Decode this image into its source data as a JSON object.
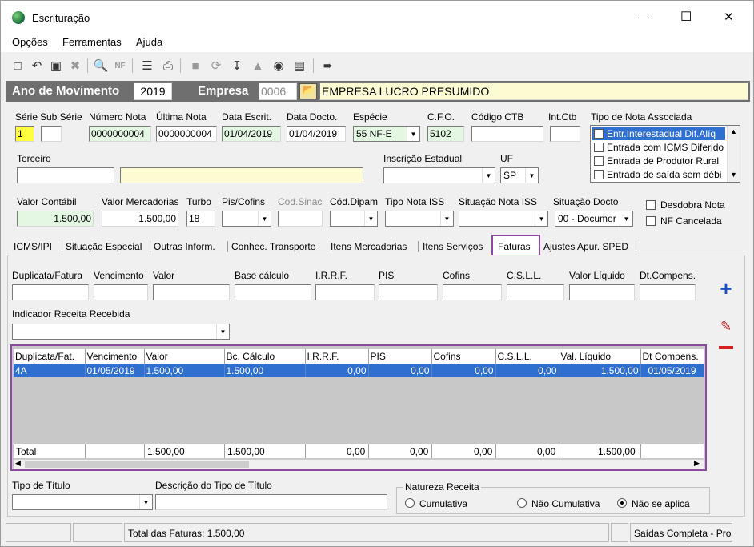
{
  "window": {
    "title": "Escrituração",
    "minimize": "—",
    "maximize": "☐",
    "close": "✕"
  },
  "menu": {
    "opcoes": "Opções",
    "ferramentas": "Ferramentas",
    "ajuda": "Ajuda"
  },
  "toolbar_icons": [
    "new-document-icon",
    "undo-icon",
    "save-icon",
    "delete-icon",
    "preview-icon",
    "nfe-icon",
    "tree-icon",
    "print-icon",
    "open-folder-icon",
    "refresh-icon",
    "import-icon",
    "tree-gray-icon",
    "money-bag-icon",
    "register-icon",
    "exit-icon"
  ],
  "header": {
    "ano_label": "Ano de Movimento",
    "ano_value": "2019",
    "empresa_label": "Empresa",
    "empresa_code": "0006",
    "empresa_name": "EMPRESA LUCRO PRESUMIDO"
  },
  "fields": {
    "serie_label": "Série",
    "serie": "1",
    "subserie_label": "Sub Série",
    "subserie": "",
    "numero_nota_label": "Número Nota",
    "numero_nota": "0000000004",
    "ultima_nota_label": "Última Nota",
    "ultima_nota": "0000000004",
    "data_escrit_label": "Data Escrit.",
    "data_escrit": "01/04/2019",
    "data_docto_label": "Data Docto.",
    "data_docto": "01/04/2019",
    "especie_label": "Espécie",
    "especie": "55  NF-E",
    "cfo_label": "C.F.O.",
    "cfo": "5102",
    "codigo_ctb_label": "Código CTB",
    "codigo_ctb": "",
    "int_ctb_label": "Int.Ctb",
    "int_ctb": "",
    "tipo_nota_assoc_label": "Tipo de Nota Associada",
    "tipo_nota_assoc_items": [
      "Entr.Interestadual Dif.Alíq",
      "Entrada com ICMS Diferido",
      "Entrada de Produtor Rural",
      "Entrada de saída sem débi"
    ],
    "terceiro_label": "Terceiro",
    "terceiro_code": "",
    "terceiro_name": "",
    "inscricao_label": "Inscrição Estadual",
    "inscricao": "",
    "uf_label": "UF",
    "uf": "SP",
    "valor_contabil_label": "Valor Contábil",
    "valor_contabil": "1.500,00",
    "valor_merc_label": "Valor Mercadorias",
    "valor_merc": "1.500,00",
    "turbo_label": "Turbo",
    "turbo": "18",
    "pis_cofins_label": "Pis/Cofins",
    "pis_cofins": "",
    "cod_sinac_label": "Cod.Sinac",
    "cod_sinac": "",
    "cod_dipam_label": "Cód.Dipam",
    "cod_dipam": "",
    "tipo_nota_iss_label": "Tipo Nota ISS",
    "tipo_nota_iss": "",
    "situacao_iss_label": "Situação Nota ISS",
    "situacao_iss": "",
    "situacao_docto_label": "Situação Docto",
    "situacao_docto": "00 - Documer",
    "desdobra_label": "Desdobra Nota",
    "nf_cancelada_label": "NF Cancelada"
  },
  "tabs": [
    "ICMS/IPI",
    "Situação Especial",
    "Outras Inform.",
    "Conhec. Transporte",
    "Itens Mercadorias",
    "Itens Serviços",
    "Faturas",
    "Ajustes Apur. SPED"
  ],
  "faturas": {
    "labels": {
      "duplicata": "Duplicata/Fatura",
      "vencimento": "Vencimento",
      "valor": "Valor",
      "base": "Base cálculo",
      "irrf": "I.R.R.F.",
      "pis": "PIS",
      "cofins": "Cofins",
      "csll": "C.S.L.L.",
      "liquido": "Valor Líquido",
      "dtcomp": "Dt.Compens."
    },
    "indicador_label": "Indicador Receita Recebida",
    "indicador": "",
    "grid_headers": [
      "Duplicata/Fat.",
      "Vencimento",
      "Valor",
      "Bc. Cálculo",
      "I.R.R.F.",
      "PIS",
      "Cofins",
      "C.S.L.L.",
      "Val. Líquido",
      "Dt Compens."
    ],
    "rows": [
      [
        "4A",
        "01/05/2019",
        "1.500,00",
        "1.500,00",
        "0,00",
        "0,00",
        "0,00",
        "0,00",
        "1.500,00",
        "01/05/2019"
      ]
    ],
    "total": [
      "Total",
      "",
      "1.500,00",
      "1.500,00",
      "0,00",
      "0,00",
      "0,00",
      "0,00",
      "1.500,00",
      ""
    ],
    "tipo_titulo_label": "Tipo de Título",
    "desc_tipo_titulo_label": "Descrição do Tipo de Título",
    "natureza_label": "Natureza Receita",
    "natureza_options": [
      "Cumulativa",
      "Não Cumulativa",
      "Não se aplica"
    ],
    "natureza_selected": "Não se aplica"
  },
  "statusbar": {
    "total_faturas": "Total das Faturas: 1.500,00",
    "mode": "Saídas Completa - Pros"
  }
}
